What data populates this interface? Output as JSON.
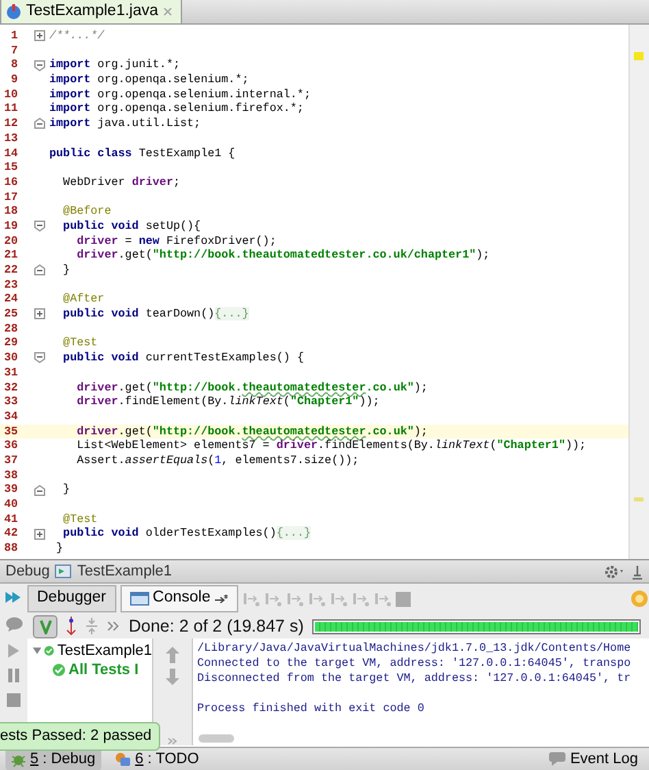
{
  "editor_tabs": [
    {
      "label": "TestExample1.java",
      "selected": true
    }
  ],
  "code_lines": [
    {
      "number": "1",
      "collapsed": true,
      "segments": [
        {
          "text": "/**...*/",
          "kind": "comment"
        }
      ]
    },
    {
      "number": "7"
    },
    {
      "number": "8",
      "collapsed": false,
      "segments": [
        {
          "text": "import",
          "kind": "keyword"
        },
        {
          "text": " org.junit.*;",
          "kind": "plain"
        }
      ]
    },
    {
      "number": "9",
      "segments": [
        {
          "text": "import",
          "kind": "keyword"
        },
        {
          "text": " org.openqa.selenium.*;",
          "kind": "plain"
        }
      ]
    },
    {
      "number": "10",
      "segments": [
        {
          "text": "import",
          "kind": "keyword"
        },
        {
          "text": " org.openqa.selenium.internal.*;",
          "kind": "plain"
        }
      ]
    },
    {
      "number": "11",
      "segments": [
        {
          "text": "import",
          "kind": "keyword"
        },
        {
          "text": " org.openqa.selenium.firefox.*;",
          "kind": "plain"
        }
      ]
    },
    {
      "number": "12",
      "block_end": true,
      "segments": [
        {
          "text": "import",
          "kind": "keyword"
        },
        {
          "text": " java.util.List;",
          "kind": "plain"
        }
      ]
    },
    {
      "number": "13"
    },
    {
      "number": "14",
      "segments": [
        {
          "text": "public class",
          "kind": "keyword"
        },
        {
          "text": " TestExample1 {",
          "kind": "plain"
        }
      ]
    },
    {
      "number": "15"
    },
    {
      "number": "16",
      "segments": [
        {
          "text": "  WebDriver ",
          "kind": "plain"
        },
        {
          "text": "driver",
          "kind": "field"
        },
        {
          "text": ";",
          "kind": "plain"
        }
      ]
    },
    {
      "number": "17"
    },
    {
      "number": "18",
      "segments": [
        {
          "text": "  @Before",
          "kind": "annotation"
        }
      ]
    },
    {
      "number": "19",
      "collapsed": false,
      "segments": [
        {
          "text": "  public void",
          "kind": "keyword"
        },
        {
          "text": " setUp(){",
          "kind": "plain"
        }
      ]
    },
    {
      "number": "20",
      "segments": [
        {
          "text": "    driver",
          "kind": "field"
        },
        {
          "text": " = ",
          "kind": "plain"
        },
        {
          "text": "new",
          "kind": "keyword"
        },
        {
          "text": " FirefoxDriver();",
          "kind": "plain"
        }
      ]
    },
    {
      "number": "21",
      "segments": [
        {
          "text": "    driver",
          "kind": "field"
        },
        {
          "text": ".get(",
          "kind": "plain"
        },
        {
          "text": "\"http://book.theautomatedtester.co.uk/chapter1\"",
          "kind": "string"
        },
        {
          "text": ");",
          "kind": "plain"
        }
      ]
    },
    {
      "number": "22",
      "block_end": true,
      "segments": [
        {
          "text": "  }",
          "kind": "plain"
        }
      ]
    },
    {
      "number": "23"
    },
    {
      "number": "24",
      "segments": [
        {
          "text": "  @After",
          "kind": "annotation"
        }
      ]
    },
    {
      "number": "25",
      "collapsed": true,
      "segments": [
        {
          "text": "  public void",
          "kind": "keyword"
        },
        {
          "text": " tearDown()",
          "kind": "plain"
        },
        {
          "text": "{...}",
          "kind": "folded"
        }
      ]
    },
    {
      "number": "28"
    },
    {
      "number": "29",
      "segments": [
        {
          "text": "  @Test",
          "kind": "annotation"
        }
      ]
    },
    {
      "number": "30",
      "collapsed": false,
      "segments": [
        {
          "text": "  public void",
          "kind": "keyword"
        },
        {
          "text": " currentTestExamples() {",
          "kind": "plain"
        }
      ]
    },
    {
      "number": "31"
    },
    {
      "number": "32",
      "segments": [
        {
          "text": "    driver",
          "kind": "field"
        },
        {
          "text": ".get(",
          "kind": "plain"
        },
        {
          "text": "\"http://book.",
          "kind": "string"
        },
        {
          "text": "theautomatedtester",
          "kind": "typo"
        },
        {
          "text": ".co.uk\"",
          "kind": "string"
        },
        {
          "text": ");",
          "kind": "plain"
        }
      ]
    },
    {
      "number": "33",
      "segments": [
        {
          "text": "    driver",
          "kind": "field"
        },
        {
          "text": ".findElement(By.",
          "kind": "plain"
        },
        {
          "text": "linkText",
          "kind": "italic"
        },
        {
          "text": "(",
          "kind": "plain"
        },
        {
          "text": "\"Chapter1\"",
          "kind": "string"
        },
        {
          "text": "));",
          "kind": "plain"
        }
      ]
    },
    {
      "number": "34"
    },
    {
      "number": "35",
      "current": true,
      "segments": [
        {
          "text": "    driver",
          "kind": "field"
        },
        {
          "text": ".get(",
          "kind": "plain"
        },
        {
          "text": "\"http://book.",
          "kind": "string"
        },
        {
          "text": "theautomatedtester",
          "kind": "typo"
        },
        {
          "text": ".co.uk\"",
          "kind": "string"
        },
        {
          "text": ");",
          "kind": "plain"
        }
      ]
    },
    {
      "number": "36",
      "segments": [
        {
          "text": "    List<WebElement> elements7 = ",
          "kind": "plain"
        },
        {
          "text": "driver",
          "kind": "field"
        },
        {
          "text": ".findElements(By.",
          "kind": "plain"
        },
        {
          "text": "linkText",
          "kind": "italic"
        },
        {
          "text": "(",
          "kind": "plain"
        },
        {
          "text": "\"Chapter1\"",
          "kind": "string"
        },
        {
          "text": "));",
          "kind": "plain"
        }
      ]
    },
    {
      "number": "37",
      "segments": [
        {
          "text": "    Assert.",
          "kind": "plain"
        },
        {
          "text": "assertEquals",
          "kind": "italic"
        },
        {
          "text": "(",
          "kind": "plain"
        },
        {
          "text": "1",
          "kind": "number"
        },
        {
          "text": ", elements7.size());",
          "kind": "plain"
        }
      ]
    },
    {
      "number": "38"
    },
    {
      "number": "39",
      "block_end": true,
      "segments": [
        {
          "text": "  }",
          "kind": "plain"
        }
      ]
    },
    {
      "number": "40"
    },
    {
      "number": "41",
      "segments": [
        {
          "text": "  @Test",
          "kind": "annotation"
        }
      ]
    },
    {
      "number": "42",
      "collapsed": true,
      "segments": [
        {
          "text": "  public void",
          "kind": "keyword"
        },
        {
          "text": " olderTestExamples()",
          "kind": "plain"
        },
        {
          "text": "{...}",
          "kind": "folded"
        }
      ]
    },
    {
      "number": "88",
      "segments": [
        {
          "text": " }",
          "kind": "plain"
        }
      ]
    }
  ],
  "debug": {
    "title": "Debug",
    "config": "TestExample1",
    "tabs": [
      {
        "label": "Debugger",
        "selected": false
      },
      {
        "label": "Console",
        "selected": true
      }
    ],
    "status": "Done: 2 of 2 (19.847 s)",
    "progress": {
      "level": 1
    },
    "tree": [
      {
        "label": "TestExample1",
        "expanded": true,
        "children": [
          {
            "label": "All Tests I"
          }
        ]
      }
    ],
    "console": {
      "lines": [
        "/Library/Java/JavaVirtualMachines/jdk1.7.0_13.jdk/Contents/Home",
        "Connected to the target VM, address: '127.0.0.1:64045', transpo",
        "Disconnected from the target VM, address: '127.0.0.1:64045', tr"
      ],
      "footer": "Process finished with exit code 0"
    },
    "tooltip": "ests Passed: 2 passed"
  },
  "tool_windows": [
    {
      "number": "5",
      "label": ": Debug",
      "selected": true
    },
    {
      "number": "6",
      "label": ": TODO",
      "selected": false
    }
  ],
  "event_log": "Event Log"
}
